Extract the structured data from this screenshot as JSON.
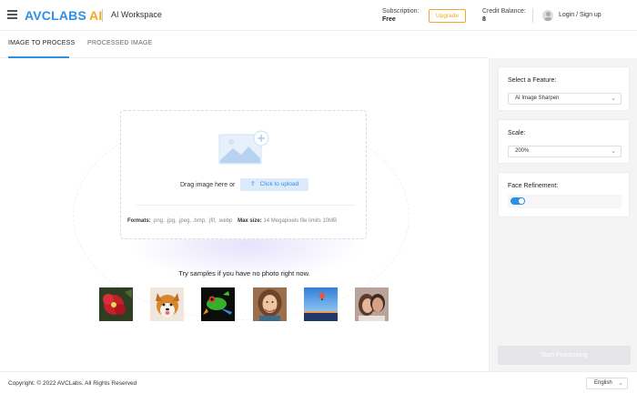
{
  "header": {
    "logo_brand": "AVCLABS",
    "logo_ai": "AI",
    "workspace_title": "AI Workspace",
    "subscription_label": "Subscription:",
    "subscription_value": "Free",
    "upgrade_label": "Upgrade",
    "credit_label": "Credit Balance:",
    "credit_value": "8",
    "login_label": "Login / Sign up",
    "brand_color": "#2d8fe6",
    "accent_color": "#f5a623"
  },
  "tabs": [
    {
      "label": "IMAGE TO PROCESS",
      "active": true
    },
    {
      "label": "PROCESSED IMAGE",
      "active": false
    }
  ],
  "dropzone": {
    "drag_text": "Drag image here or",
    "upload_label": "Click to upload",
    "formats_label": "Formats:",
    "formats_value": ".png, .jpg, .jpeg, .bmp, .jfif, .webp",
    "maxsize_label": "Max size:",
    "maxsize_value": "14 Megapixels file limits 10MB"
  },
  "samples": {
    "title": "Try samples if you have no photo right now.",
    "items": [
      {
        "icon": "flower-sample"
      },
      {
        "icon": "dog-sample"
      },
      {
        "icon": "frog-sample"
      },
      {
        "icon": "woman-portrait-sample"
      },
      {
        "icon": "balloon-landscape-sample"
      },
      {
        "icon": "couple-portrait-sample"
      }
    ]
  },
  "panel": {
    "feature_label": "Select a Feature:",
    "feature_value": "AI Image Sharpen",
    "scale_label": "Scale:",
    "scale_value": "200%",
    "face_label": "Face Refinement:",
    "face_enabled": true,
    "start_label": "Start Processing"
  },
  "footer": {
    "copyright": "Copyright: © 2022 AVCLabs. All Rights Reserved",
    "language": "English"
  }
}
